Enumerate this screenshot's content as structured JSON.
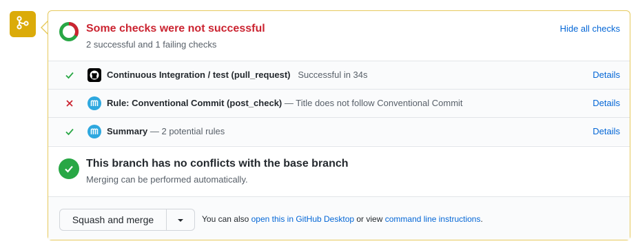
{
  "header": {
    "title": "Some checks were not successful",
    "subtitle": "2 successful and 1 failing checks",
    "hide_link": "Hide all checks"
  },
  "checks": [
    {
      "status": "success",
      "app_icon": "github-icon",
      "name": "Continuous Integration / test (pull_request)",
      "description": "Successful in 34s",
      "details": "Details"
    },
    {
      "status": "failure",
      "app_icon": "mergify-icon",
      "name": "Rule: Conventional Commit (post_check)",
      "description": "— Title does not follow Conventional Commit",
      "details": "Details"
    },
    {
      "status": "success",
      "app_icon": "mergify-icon",
      "name": "Summary",
      "description": "— 2 potential rules",
      "details": "Details"
    }
  ],
  "conflict": {
    "title": "This branch has no conflicts with the base branch",
    "subtitle": "Merging can be performed automatically."
  },
  "footer": {
    "merge_button": "Squash and merge",
    "text_prefix": "You can also ",
    "desktop_link": "open this in GitHub Desktop",
    "text_middle": " or view ",
    "cli_link": "command line instructions",
    "text_suffix": "."
  },
  "colors": {
    "success": "#28a745",
    "failure": "#cb2431",
    "link": "#0366d6",
    "badge": "#dbab09",
    "border": "#e6c95b"
  }
}
